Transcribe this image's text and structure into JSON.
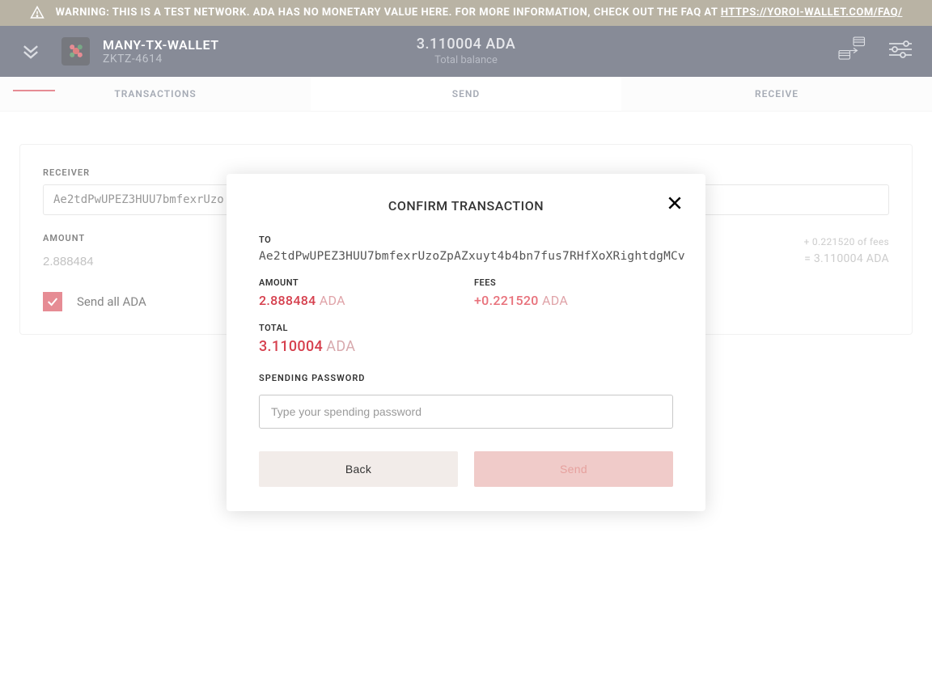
{
  "warning": {
    "prefix": "WARNING: THIS IS A TEST NETWORK. ADA HAS NO MONETARY VALUE HERE. FOR MORE INFORMATION, CHECK OUT THE FAQ AT ",
    "link": "HTTPS://YOROI-WALLET.COM/FAQ/"
  },
  "header": {
    "wallet_name": "MANY-TX-WALLET",
    "wallet_plate": "ZKTZ-4614",
    "balance": "3.110004 ADA",
    "balance_label": "Total balance"
  },
  "tabs": {
    "transactions": "TRANSACTIONS",
    "send": "SEND",
    "receive": "RECEIVE"
  },
  "form": {
    "receiver_label": "RECEIVER",
    "receiver_value": "Ae2tdPwUPEZ3HUU7bmfexrUzo",
    "amount_label": "AMOUNT",
    "amount_value": "2.888484",
    "fees_text": "+ 0.221520 of fees",
    "equals_text": "= 3.110004 ADA",
    "sendall_label": "Send all ADA"
  },
  "modal": {
    "title": "CONFIRM TRANSACTION",
    "to_label": "TO",
    "to_value": "Ae2tdPwUPEZ3HUU7bmfexrUzoZpAZxuyt4b4bn7fus7RHfXoXRightdgMCv",
    "amount_label": "AMOUNT",
    "amount_value": "2.888484",
    "fees_label": "FEES",
    "fees_value": "+0.221520",
    "total_label": "TOTAL",
    "total_value": "3.110004",
    "currency": "ADA",
    "pwd_label": "SPENDING PASSWORD",
    "pwd_placeholder": "Type your spending password",
    "back": "Back",
    "send": "Send"
  }
}
